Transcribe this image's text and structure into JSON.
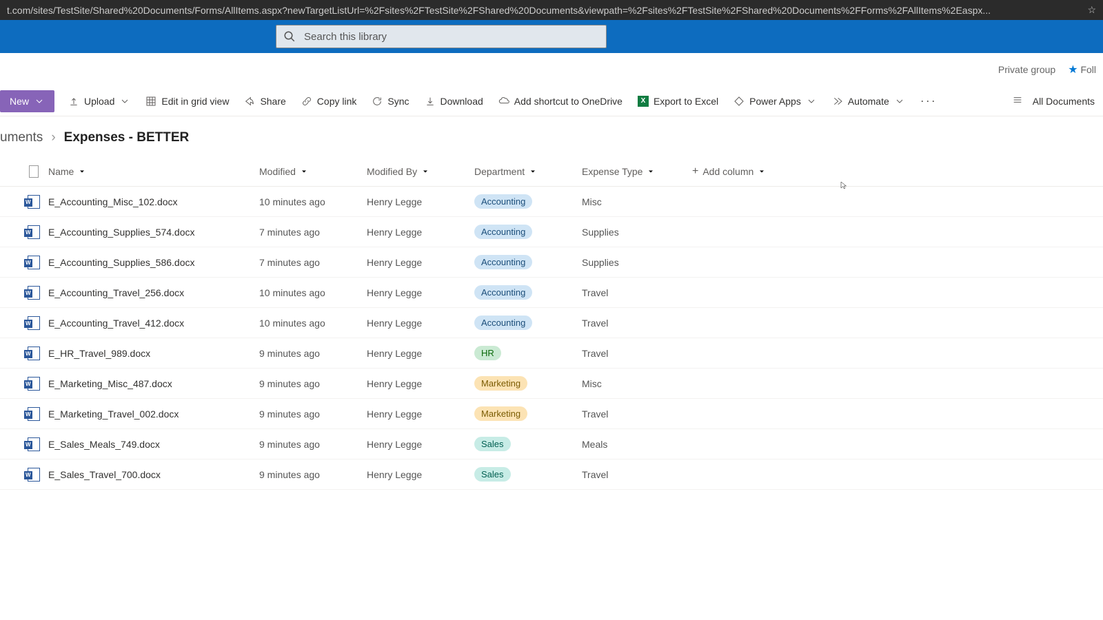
{
  "address_bar": "t.com/sites/TestSite/Shared%20Documents/Forms/AllItems.aspx?newTargetListUrl=%2Fsites%2FTestSite%2FShared%20Documents&viewpath=%2Fsites%2FTestSite%2FShared%20Documents%2FForms%2FAllItems%2Easpx...",
  "search": {
    "placeholder": "Search this library"
  },
  "group": {
    "privacy": "Private group",
    "follow": "Foll"
  },
  "commands": {
    "new": "New",
    "upload": "Upload",
    "edit_grid": "Edit in grid view",
    "share": "Share",
    "copy_link": "Copy link",
    "sync": "Sync",
    "download": "Download",
    "shortcut": "Add shortcut to OneDrive",
    "export": "Export to Excel",
    "power_apps": "Power Apps",
    "automate": "Automate",
    "view": "All Documents"
  },
  "breadcrumb": {
    "parent": "uments",
    "current": "Expenses - BETTER"
  },
  "columns": {
    "name": "Name",
    "modified": "Modified",
    "modified_by": "Modified By",
    "department": "Department",
    "expense_type": "Expense Type",
    "add": "Add column"
  },
  "rows": [
    {
      "name": "E_Accounting_Misc_102.docx",
      "modified": "10 minutes ago",
      "by": "Henry Legge",
      "dept": "Accounting",
      "dept_cls": "tag-acc",
      "exp": "Misc"
    },
    {
      "name": "E_Accounting_Supplies_574.docx",
      "modified": "7 minutes ago",
      "by": "Henry Legge",
      "dept": "Accounting",
      "dept_cls": "tag-acc",
      "exp": "Supplies"
    },
    {
      "name": "E_Accounting_Supplies_586.docx",
      "modified": "7 minutes ago",
      "by": "Henry Legge",
      "dept": "Accounting",
      "dept_cls": "tag-acc",
      "exp": "Supplies"
    },
    {
      "name": "E_Accounting_Travel_256.docx",
      "modified": "10 minutes ago",
      "by": "Henry Legge",
      "dept": "Accounting",
      "dept_cls": "tag-acc",
      "exp": "Travel"
    },
    {
      "name": "E_Accounting_Travel_412.docx",
      "modified": "10 minutes ago",
      "by": "Henry Legge",
      "dept": "Accounting",
      "dept_cls": "tag-acc",
      "exp": "Travel"
    },
    {
      "name": "E_HR_Travel_989.docx",
      "modified": "9 minutes ago",
      "by": "Henry Legge",
      "dept": "HR",
      "dept_cls": "tag-hr",
      "exp": "Travel"
    },
    {
      "name": "E_Marketing_Misc_487.docx",
      "modified": "9 minutes ago",
      "by": "Henry Legge",
      "dept": "Marketing",
      "dept_cls": "tag-mkt",
      "exp": "Misc"
    },
    {
      "name": "E_Marketing_Travel_002.docx",
      "modified": "9 minutes ago",
      "by": "Henry Legge",
      "dept": "Marketing",
      "dept_cls": "tag-mkt",
      "exp": "Travel"
    },
    {
      "name": "E_Sales_Meals_749.docx",
      "modified": "9 minutes ago",
      "by": "Henry Legge",
      "dept": "Sales",
      "dept_cls": "tag-sales",
      "exp": "Meals"
    },
    {
      "name": "E_Sales_Travel_700.docx",
      "modified": "9 minutes ago",
      "by": "Henry Legge",
      "dept": "Sales",
      "dept_cls": "tag-sales",
      "exp": "Travel"
    }
  ]
}
